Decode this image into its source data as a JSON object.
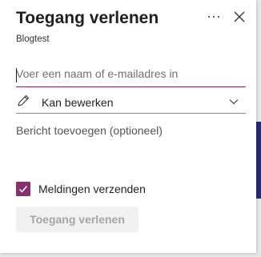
{
  "dialog": {
    "title": "Toegang verlenen",
    "subtitle": "Blogtest",
    "more_icon": "more-horizontal-icon",
    "close_icon": "close-icon"
  },
  "name_input": {
    "placeholder": "Voer een naam of e-mailadres in",
    "value": ""
  },
  "permission": {
    "icon": "pencil-icon",
    "selected": "Kan bewerken",
    "dropdown_icon": "chevron-down-icon"
  },
  "message": {
    "placeholder": "Bericht toevoegen (optioneel)"
  },
  "notifications": {
    "label": "Meldingen verzenden",
    "checked": true
  },
  "submit": {
    "label": "Toegang verlenen"
  },
  "colors": {
    "accent": "#86306e",
    "input_underline": "#a4136f",
    "disabled_button_bg": "#f1f1f1",
    "disabled_button_text": "#a5a5a5"
  }
}
